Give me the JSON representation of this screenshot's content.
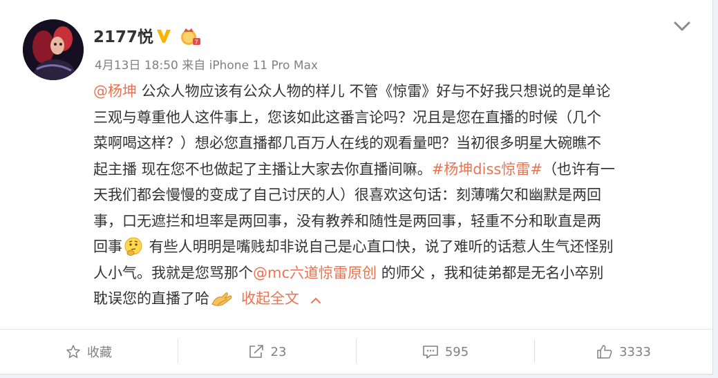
{
  "post": {
    "author": "2177悦",
    "time": "4月13日 18:50",
    "source_prefix": "来自",
    "source": "iPhone 11 Pro Max",
    "content": {
      "line1_mention": "@杨坤",
      "line1_text": " 公众人物应该有公众人物的样儿 不管《惊雷》好与不好我只想说的是单论",
      "line2": "三观与尊重他人这件事上，您该如此这番言论吗？况且是您在直播的时候（几个",
      "line3": "菜啊喝这样？）想必您直播都几百万人在线的观看量吧？当初很多明星大碗瞧不",
      "line4_text": "起主播 现在您不也做起了主播让大家去你直播间嘛。",
      "line4_topic": "#杨坤diss惊雷#",
      "line4_tail": "（也许有一",
      "line5": "天我们都会慢慢的变成了自己讨厌的人）很喜欢这句话：刻薄嘴欠和幽默是两回",
      "line6": "事，口无遮拦和坦率是两回事，没有教养和随性是两回事，轻重不分和耿直是两",
      "line7_pre": "回事",
      "line7_post": " 有些人明明是嘴贱却非说自己是心直口快，说了难听的话惹人生气还怪别",
      "line8_pre": "人小气。我就是您骂那个",
      "line8_mention": "@mc六道惊雷原创",
      "line8_post": " 的师父 ，我和徒弟都是无名小卒别",
      "line9": "耽误您的直播了哈",
      "collapse_label": "收起全文"
    }
  },
  "actions": {
    "favorite_label": "收藏",
    "repost_count": "23",
    "comment_count": "595",
    "like_count": "3333"
  },
  "icons": {
    "verified": "verified-v-icon",
    "member": "member-crown-icon",
    "more": "chevron-down-icon",
    "thinking_emoji": "thinking-face-emoji",
    "clap_emoji": "clap-hands-emoji",
    "collapse": "chevron-up-icon",
    "favorite": "star-icon",
    "repost": "share-arrow-icon",
    "comment": "comment-bubble-icon",
    "like": "thumbs-up-icon"
  },
  "colors": {
    "link": "#eb7350",
    "verified": "#f7b500",
    "text": "#333333",
    "meta": "#808080"
  }
}
